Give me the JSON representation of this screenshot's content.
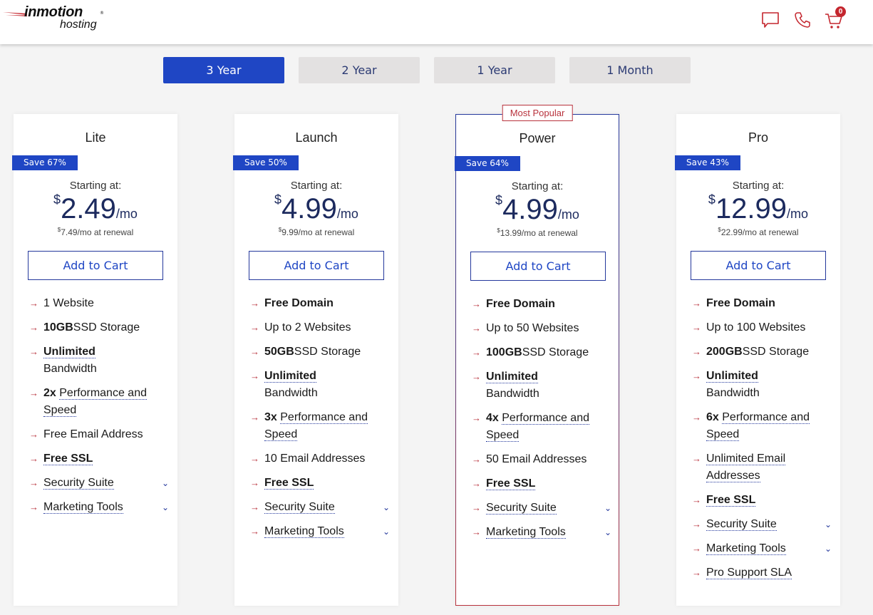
{
  "header": {
    "logo_brand": "inmotion",
    "logo_sub": "hosting",
    "logo_reg": "®",
    "icons": [
      "chat-icon",
      "phone-icon",
      "cart-icon"
    ],
    "cart_count": "0",
    "accent_color": "#c4262e"
  },
  "billing_tabs": [
    {
      "label": "3 Year",
      "active": true
    },
    {
      "label": "2 Year",
      "active": false
    },
    {
      "label": "1 Year",
      "active": false
    },
    {
      "label": "1 Month",
      "active": false
    }
  ],
  "starting_label": "Starting at:",
  "currency": "$",
  "per_month": "/mo",
  "renewal_suffix": "/mo at renewal",
  "add_to_cart_label": "Add to Cart",
  "most_popular_label": "Most Popular",
  "plans": [
    {
      "name": "Lite",
      "save": "Save 67%",
      "price": "2.49",
      "renewal": "7.49",
      "features": [
        {
          "bold": "",
          "text": "1 Website",
          "dotted": false,
          "expand": false
        },
        {
          "bold": "10GB",
          "text": "SSD Storage",
          "dotted": false,
          "expand": false
        },
        {
          "bold": "Unlimited",
          "text": "Bandwidth",
          "dotted": true,
          "expand": false
        },
        {
          "bold": "2x",
          "text": "Performance and Speed",
          "dotted": true,
          "expand": false
        },
        {
          "bold": "",
          "text": "Free Email Address",
          "dotted": false,
          "expand": false
        },
        {
          "bold": "Free SSL",
          "text": "",
          "dotted": true,
          "expand": false
        },
        {
          "bold": "",
          "text": "Security Suite",
          "dotted": true,
          "expand": true
        },
        {
          "bold": "",
          "text": "Marketing Tools",
          "dotted": true,
          "expand": true
        }
      ]
    },
    {
      "name": "Launch",
      "save": "Save 50%",
      "price": "4.99",
      "renewal": "9.99",
      "features": [
        {
          "bold": "Free Domain",
          "text": "",
          "dotted": false,
          "expand": false
        },
        {
          "bold": "",
          "text": "Up to 2 Websites",
          "dotted": false,
          "expand": false
        },
        {
          "bold": "50GB",
          "text": "SSD Storage",
          "dotted": false,
          "expand": false
        },
        {
          "bold": "Unlimited",
          "text": "Bandwidth",
          "dotted": true,
          "expand": false
        },
        {
          "bold": "3x",
          "text": "Performance and Speed",
          "dotted": true,
          "expand": false
        },
        {
          "bold": "",
          "text": "10 Email Addresses",
          "dotted": false,
          "expand": false
        },
        {
          "bold": "Free SSL",
          "text": "",
          "dotted": true,
          "expand": false
        },
        {
          "bold": "",
          "text": "Security Suite",
          "dotted": true,
          "expand": true
        },
        {
          "bold": "",
          "text": "Marketing Tools",
          "dotted": true,
          "expand": true
        }
      ]
    },
    {
      "name": "Power",
      "save": "Save 64%",
      "price": "4.99",
      "renewal": "13.99",
      "featured": true,
      "features": [
        {
          "bold": "Free Domain",
          "text": "",
          "dotted": false,
          "expand": false
        },
        {
          "bold": "",
          "text": "Up to 50 Websites",
          "dotted": false,
          "expand": false
        },
        {
          "bold": "100GB",
          "text": "SSD Storage",
          "dotted": false,
          "expand": false
        },
        {
          "bold": "Unlimited",
          "text": "Bandwidth",
          "dotted": true,
          "expand": false
        },
        {
          "bold": "4x",
          "text": "Performance and Speed",
          "dotted": true,
          "expand": false
        },
        {
          "bold": "",
          "text": "50 Email Addresses",
          "dotted": false,
          "expand": false
        },
        {
          "bold": "Free SSL",
          "text": "",
          "dotted": true,
          "expand": false
        },
        {
          "bold": "",
          "text": "Security Suite",
          "dotted": true,
          "expand": true
        },
        {
          "bold": "",
          "text": "Marketing Tools",
          "dotted": true,
          "expand": true
        }
      ]
    },
    {
      "name": "Pro",
      "save": "Save 43%",
      "price": "12.99",
      "renewal": "22.99",
      "features": [
        {
          "bold": "Free Domain",
          "text": "",
          "dotted": false,
          "expand": false
        },
        {
          "bold": "",
          "text": "Up to 100 Websites",
          "dotted": false,
          "expand": false
        },
        {
          "bold": "200GB",
          "text": "SSD Storage",
          "dotted": false,
          "expand": false
        },
        {
          "bold": "Unlimited",
          "text": "Bandwidth",
          "dotted": true,
          "expand": false
        },
        {
          "bold": "6x",
          "text": "Performance and Speed",
          "dotted": true,
          "expand": false
        },
        {
          "bold": "",
          "text": "Unlimited Email Addresses",
          "dotted": true,
          "expand": false
        },
        {
          "bold": "Free SSL",
          "text": "",
          "dotted": true,
          "expand": false
        },
        {
          "bold": "",
          "text": "Security Suite",
          "dotted": true,
          "expand": true
        },
        {
          "bold": "",
          "text": "Marketing Tools",
          "dotted": true,
          "expand": true
        },
        {
          "bold": "",
          "text": "Pro Support SLA",
          "dotted": true,
          "expand": false
        }
      ]
    }
  ]
}
